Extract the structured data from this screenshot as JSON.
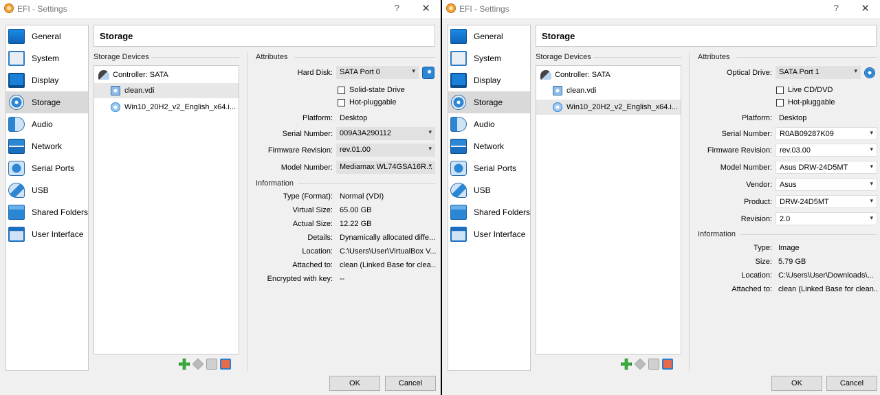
{
  "left": {
    "title": "EFI - Settings",
    "help_glyph": "?",
    "close_glyph": "✕",
    "nav": [
      {
        "label": "General",
        "icon": "general-icon"
      },
      {
        "label": "System",
        "icon": "system-icon"
      },
      {
        "label": "Display",
        "icon": "display-icon"
      },
      {
        "label": "Storage",
        "icon": "storage-icon"
      },
      {
        "label": "Audio",
        "icon": "audio-icon"
      },
      {
        "label": "Network",
        "icon": "network-icon"
      },
      {
        "label": "Serial Ports",
        "icon": "serial-ports-icon"
      },
      {
        "label": "USB",
        "icon": "usb-icon"
      },
      {
        "label": "Shared Folders",
        "icon": "shared-folders-icon"
      },
      {
        "label": "User Interface",
        "icon": "user-interface-icon"
      }
    ],
    "page_title": "Storage",
    "storage_devices_label": "Storage Devices",
    "tree": {
      "controller": "Controller: SATA",
      "disk": "clean.vdi",
      "optical": "Win10_20H2_v2_English_x64.i..."
    },
    "attributes_label": "Attributes",
    "attrs": {
      "hard_disk_label": "Hard Disk:",
      "hard_disk_value": "SATA Port 0",
      "ssd_label": "Solid-state Drive",
      "hotplug_label": "Hot-pluggable",
      "platform_label": "Platform:",
      "platform_value": "Desktop",
      "serial_label": "Serial Number:",
      "serial_value": "009A3A290112",
      "firmware_label": "Firmware Revision:",
      "firmware_value": "rev.01.00",
      "model_label": "Model Number:",
      "model_value": "Mediamax WL74GSA16R..."
    },
    "information_label": "Information",
    "info": [
      {
        "label": "Type (Format):",
        "value": "Normal (VDI)"
      },
      {
        "label": "Virtual Size:",
        "value": "65.00 GB"
      },
      {
        "label": "Actual Size:",
        "value": "12.22 GB"
      },
      {
        "label": "Details:",
        "value": "Dynamically allocated diffe..."
      },
      {
        "label": "Location:",
        "value": "C:\\Users\\User\\VirtualBox V..."
      },
      {
        "label": "Attached to:",
        "value": "clean (Linked Base for clea..."
      },
      {
        "label": "Encrypted with key:",
        "value": "--"
      }
    ],
    "ok": "OK",
    "cancel": "Cancel"
  },
  "right": {
    "title": "EFI - Settings",
    "help_glyph": "?",
    "close_glyph": "✕",
    "nav": [
      {
        "label": "General",
        "icon": "general-icon"
      },
      {
        "label": "System",
        "icon": "system-icon"
      },
      {
        "label": "Display",
        "icon": "display-icon"
      },
      {
        "label": "Storage",
        "icon": "storage-icon"
      },
      {
        "label": "Audio",
        "icon": "audio-icon"
      },
      {
        "label": "Network",
        "icon": "network-icon"
      },
      {
        "label": "Serial Ports",
        "icon": "serial-ports-icon"
      },
      {
        "label": "USB",
        "icon": "usb-icon"
      },
      {
        "label": "Shared Folders",
        "icon": "shared-folders-icon"
      },
      {
        "label": "User Interface",
        "icon": "user-interface-icon"
      }
    ],
    "page_title": "Storage",
    "storage_devices_label": "Storage Devices",
    "tree": {
      "controller": "Controller: SATA",
      "disk": "clean.vdi",
      "optical": "Win10_20H2_v2_English_x64.i..."
    },
    "attributes_label": "Attributes",
    "attrs": {
      "optical_label": "Optical Drive:",
      "optical_value": "SATA Port 1",
      "live_label": "Live CD/DVD",
      "hotplug_label": "Hot-pluggable",
      "platform_label": "Platform:",
      "platform_value": "Desktop",
      "serial_label": "Serial Number:",
      "serial_value": "R0AB09287K09",
      "firmware_label": "Firmware Revision:",
      "firmware_value": "rev.03.00",
      "model_label": "Model Number:",
      "model_value": "Asus DRW-24D5MT",
      "vendor_label": "Vendor:",
      "vendor_value": "Asus",
      "product_label": "Product:",
      "product_value": "DRW-24D5MT",
      "revision_label": "Revision:",
      "revision_value": "2.0"
    },
    "information_label": "Information",
    "info": [
      {
        "label": "Type:",
        "value": "Image"
      },
      {
        "label": "Size:",
        "value": "5.79 GB"
      },
      {
        "label": "Location:",
        "value": "C:\\Users\\User\\Downloads\\..."
      },
      {
        "label": "Attached to:",
        "value": "clean (Linked Base for clean..."
      }
    ],
    "ok": "OK",
    "cancel": "Cancel"
  }
}
